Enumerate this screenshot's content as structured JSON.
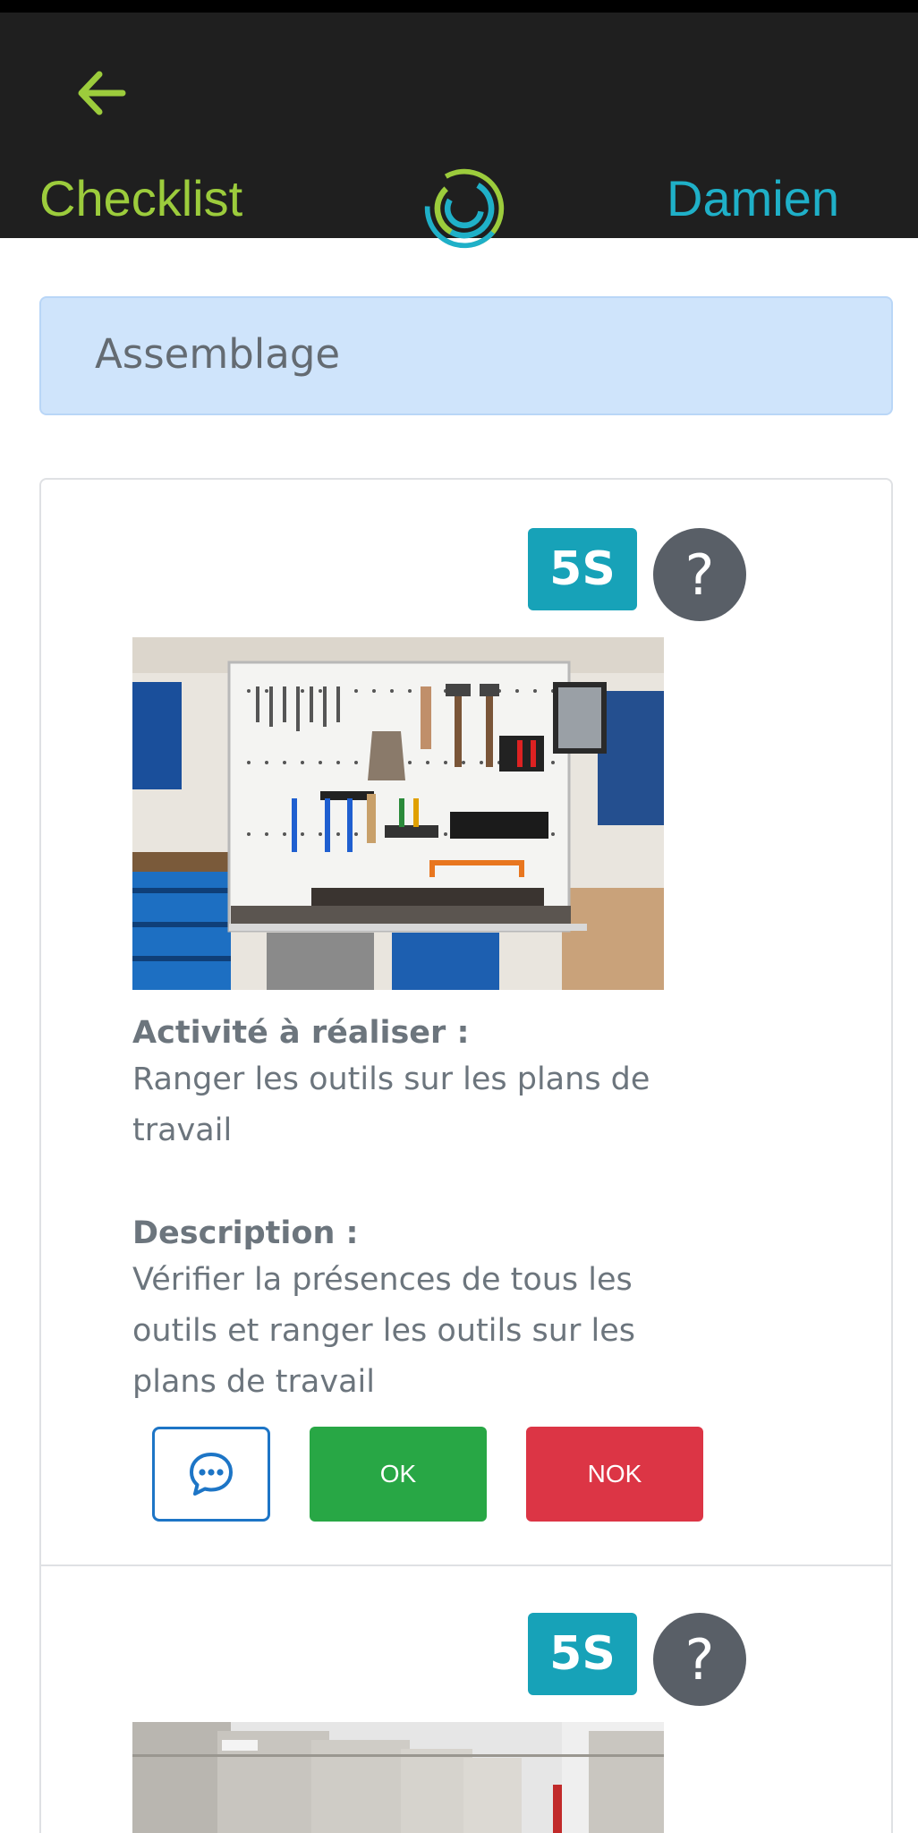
{
  "header": {
    "title": "Checklist",
    "user": "Damien",
    "back_icon": "arrow-left-icon",
    "logo_icon": "swirl-logo"
  },
  "section": {
    "title": "Assemblage"
  },
  "items": [
    {
      "badge": "5S",
      "help": "?",
      "image": "tool-wall-photo",
      "activity_label": "Activité à réaliser :",
      "activity": "Ranger les outils sur les plans de travail",
      "description_label": "Description :",
      "description": "Vérifier la présences de tous les outils et ranger les outils sur les plans de travail",
      "comment_icon": "chat-bubble-icon",
      "ok_label": "OK",
      "nok_label": "NOK"
    },
    {
      "badge": "5S",
      "help": "?",
      "image": "steel-tanks-photo"
    }
  ],
  "colors": {
    "header_bg": "#1f1f1f",
    "accent_green": "#9ccc3c",
    "accent_cyan": "#1fb0c8",
    "section_bg": "#cfe4fb",
    "badge": "#17a2b8",
    "ok": "#28a745",
    "nok": "#dc3545",
    "comment_border": "#1d75c6"
  }
}
